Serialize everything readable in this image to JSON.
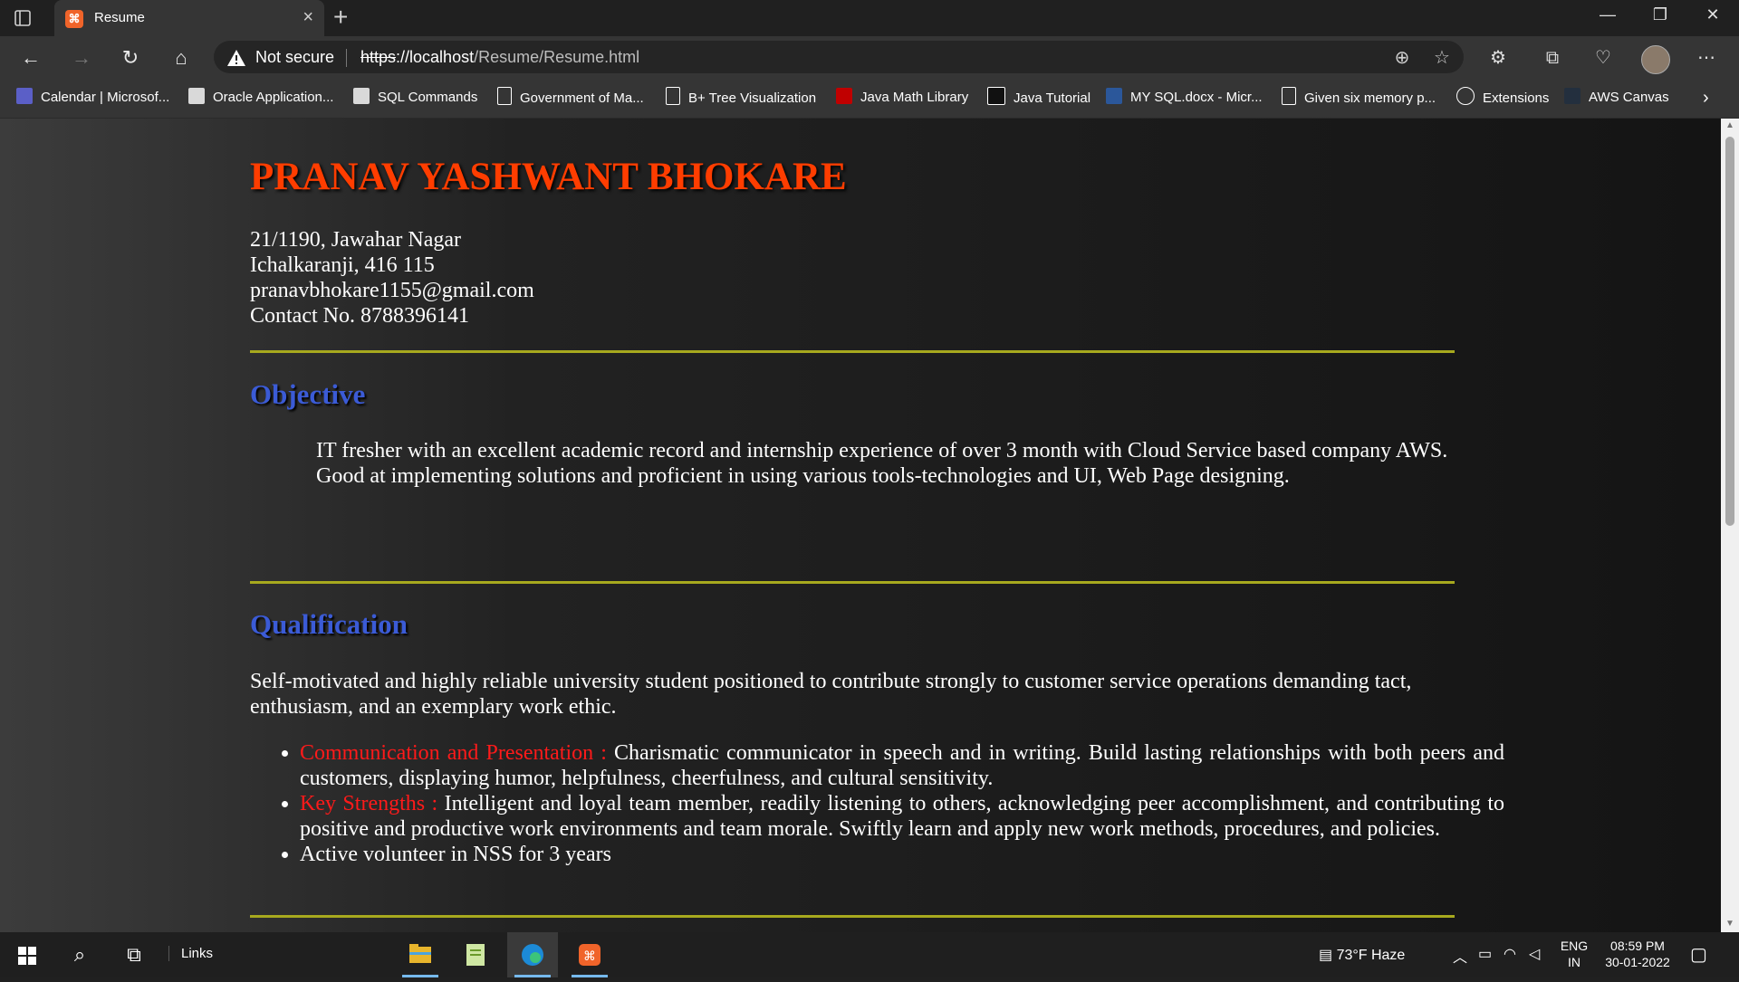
{
  "browser": {
    "tab_title": "Resume",
    "new_tab": "+",
    "close_tab": "×",
    "security_label": "Not secure",
    "url_protocol": "https",
    "url_host": "://localhost",
    "url_path": "/Resume/Resume.html",
    "bookmarks": [
      {
        "label": "Calendar | Microsof...",
        "icon_color": "#5b5fc7"
      },
      {
        "label": "Oracle Application...",
        "icon_color": "#d9d9d9"
      },
      {
        "label": "SQL Commands",
        "icon_color": "#d9d9d9"
      },
      {
        "label": "Government of Ma...",
        "icon_color": "#ffffff"
      },
      {
        "label": "B+ Tree Visualization",
        "icon_color": "#ffffff"
      },
      {
        "label": "Java Math Library",
        "icon_color": "#c00000"
      },
      {
        "label": "Java Tutorial",
        "icon_color": "#111111"
      },
      {
        "label": "MY SQL.docx - Micr...",
        "icon_color": "#2b579a"
      },
      {
        "label": "Given six memory p...",
        "icon_color": "#ffffff"
      },
      {
        "label": "Extensions",
        "icon_color": "#ffffff"
      },
      {
        "label": "AWS Canvas",
        "icon_color": "#232f3e"
      }
    ]
  },
  "resume": {
    "name": "PRANAV YASHWANT BHOKARE",
    "address_line1": "21/1190, Jawahar Nagar",
    "address_line2": "Ichalkaranji, 416 115",
    "email": "pranavbhokare1155@gmail.com",
    "contact": "Contact No. 8788396141",
    "objective_heading": "Objective",
    "objective_line1": "IT fresher with an excellent academic record and internship experience of over 3 month with Cloud Service based company AWS.",
    "objective_line2": "Good at implementing solutions and proficient in using various tools-technologies and UI, Web Page designing.",
    "qualification_heading": "Qualification",
    "qualification_text": "Self-motivated and highly reliable university student positioned to contribute strongly to customer service operations demanding tact, enthusiasm, and an exemplary work ethic.",
    "items": [
      {
        "key": "Communication and Presentation : ",
        "text": "Charismatic communicator in speech and in writing. Build lasting relationships with both peers and customers, displaying humor, helpfulness, cheerfulness, and cultural sensitivity."
      },
      {
        "key": "Key Strengths : ",
        "text": "Intelligent and loyal team member, readily listening to others, acknowledging peer accomplishment, and contributing to positive and productive work environments and team morale. Swiftly learn and apply new work methods, procedures, and policies."
      },
      {
        "key": "",
        "text": "Active volunteer in NSS for 3 years"
      }
    ]
  },
  "taskbar": {
    "links_label": "Links",
    "weather": "73°F  Haze",
    "lang_line1": "ENG",
    "lang_line2": "IN",
    "time": "08:59 PM",
    "date": "30-01-2022"
  }
}
